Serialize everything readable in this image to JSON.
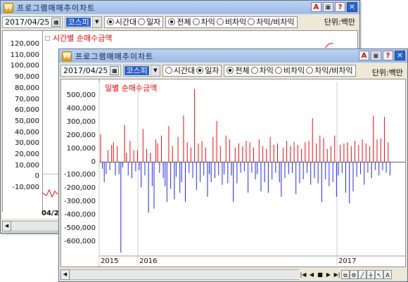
{
  "back_window": {
    "title": "프로그램매매추이차트",
    "date": "2017/04/25",
    "market": "코스피",
    "period_options": [
      "시간대",
      "일자"
    ],
    "filter_options": [
      "전체",
      "차익",
      "비차익",
      "차익/비차익"
    ],
    "unit": "단위:백만",
    "chart_title": "시간별 순매수금액",
    "y_ticks": [
      "120,000",
      "110,000",
      "100,000",
      "90,000",
      "80,000",
      "70,000",
      "60,000",
      "50,000",
      "40,000",
      "30,000",
      "20,000",
      "10,000",
      "0",
      "-10,000"
    ],
    "date_bottom": "04/2"
  },
  "front_window": {
    "title": "프로그램매매추이차트",
    "date": "2017/04/25",
    "market": "코스피",
    "period_options": [
      "시간대",
      "일자"
    ],
    "filter_options": [
      "전체",
      "차익",
      "비차익",
      "차익/비차익"
    ],
    "unit": "단위:백만",
    "toolbar_icons": [
      "A-icon",
      "print-icon",
      "help-icon",
      "close-icon"
    ]
  },
  "chart_data": {
    "type": "bar",
    "title": "일별 순매수금액",
    "xlabel": "",
    "ylabel": "",
    "ylim": [
      -700000,
      600000
    ],
    "y_ticks": [
      "500,000",
      "400,000",
      "300,000",
      "200,000",
      "100,000",
      "0",
      "-100,000",
      "-200,000",
      "-300,000",
      "-400,000",
      "-500,000",
      "-600,000"
    ],
    "x_ticks": [
      {
        "label": "2015",
        "index": 0
      },
      {
        "label": "2016",
        "index": 21
      },
      {
        "label": "2017",
        "index": 129
      }
    ],
    "colors": {
      "positive": "#e00000",
      "negative": "#1a1adf"
    },
    "values": [
      210000,
      -50000,
      -150000,
      -90000,
      90000,
      -60000,
      130000,
      150000,
      -100000,
      120000,
      -90000,
      -680000,
      -40000,
      280000,
      70000,
      -100000,
      160000,
      -120000,
      90000,
      -70000,
      90000,
      -60000,
      -190000,
      250000,
      -100000,
      100000,
      -380000,
      70000,
      -180000,
      -350000,
      170000,
      140000,
      -80000,
      200000,
      -120000,
      -180000,
      -300000,
      270000,
      -200000,
      120000,
      -280000,
      -110000,
      190000,
      -230000,
      -150000,
      350000,
      -300000,
      150000,
      -80000,
      110000,
      -120000,
      550000,
      -210000,
      140000,
      -150000,
      160000,
      -100000,
      110000,
      -260000,
      -90000,
      -150000,
      190000,
      -120000,
      310000,
      -100000,
      120000,
      -170000,
      -90000,
      200000,
      -160000,
      170000,
      -100000,
      -300000,
      110000,
      -160000,
      140000,
      -80000,
      120000,
      -70000,
      160000,
      -230000,
      150000,
      -80000,
      110000,
      -130000,
      -90000,
      170000,
      -220000,
      120000,
      -150000,
      100000,
      -230000,
      190000,
      -130000,
      130000,
      -80000,
      140000,
      -150000,
      -260000,
      110000,
      -120000,
      160000,
      -90000,
      120000,
      -80000,
      150000,
      -240000,
      130000,
      -160000,
      100000,
      -130000,
      150000,
      -80000,
      160000,
      -170000,
      330000,
      -120000,
      140000,
      -160000,
      200000,
      -300000,
      180000,
      -130000,
      100000,
      -180000,
      120000,
      -150000,
      200000,
      -260000,
      -100000,
      130000,
      -80000,
      140000,
      -230000,
      150000,
      -310000,
      120000,
      -220000,
      160000,
      -110000,
      130000,
      -90000,
      170000,
      -170000,
      140000,
      -80000,
      120000,
      -120000,
      350000,
      -60000,
      170000,
      -100000,
      180000,
      -60000,
      340000,
      -80000,
      150000,
      -100000
    ]
  }
}
